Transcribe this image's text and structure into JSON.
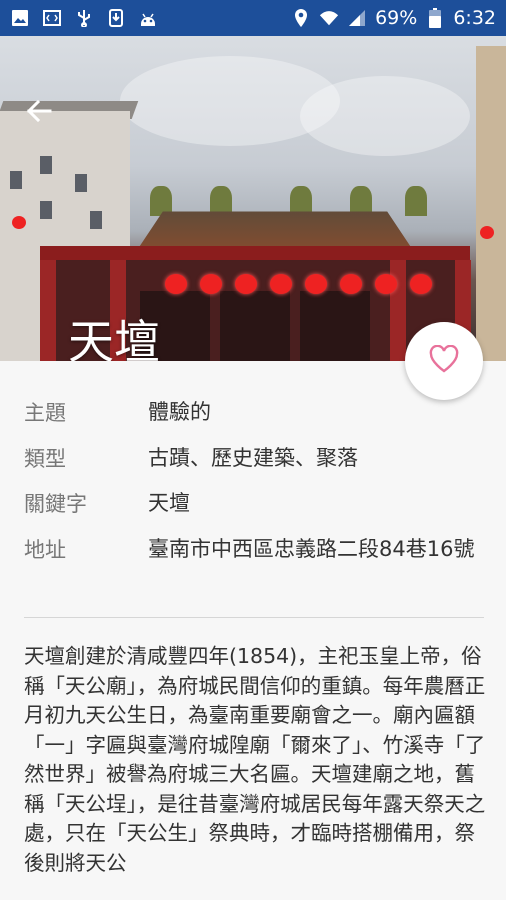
{
  "status_bar": {
    "battery": "69%",
    "time": "6:32",
    "bg_color": "#1d4f9a",
    "left_icons": [
      "image-icon",
      "code-icon",
      "usb-icon",
      "download-icon",
      "android-icon"
    ],
    "right_icons": [
      "location-icon",
      "wifi-icon",
      "signal-icon",
      "battery-icon"
    ]
  },
  "hero": {
    "title": "天壇"
  },
  "details": [
    {
      "label": "主題",
      "value": "體驗的"
    },
    {
      "label": "類型",
      "value": "古蹟、歷史建築、聚落"
    },
    {
      "label": "關鍵字",
      "value": "天壇"
    },
    {
      "label": "地址",
      "value": "臺南市中西區忠義路二段84巷16號"
    }
  ],
  "description": "天壇創建於清咸豐四年(1854)，主祀玉皇上帝，俗稱「天公廟」，為府城民間信仰的重鎮。每年農曆正月初九天公生日，為臺南重要廟會之一。廟內匾額「一」字匾與臺灣府城隍廟「爾來了」、竹溪寺「了然世界」被譽為府城三大名匾。天壇建廟之地，舊稱「天公埕」，是往昔臺灣府城居民每年露天祭天之處，只在「天公生」祭典時，才臨時搭棚備用，祭後則將天公",
  "colors": {
    "favorite": "#e8729b"
  }
}
